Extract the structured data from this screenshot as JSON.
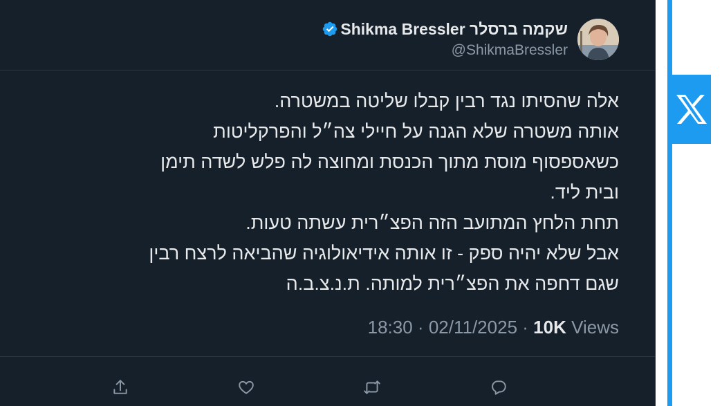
{
  "tweet": {
    "author": {
      "display_name": "Shikma Bressler שקמה ברסלר",
      "handle": "@ShikmaBressler",
      "verified": true
    },
    "text_lines": [
      "אלה שהסיתו נגד רבין קבלו שליטה במשטרה.",
      "אותה משטרה שלא הגנה על חיילי צה״ל והפרקליטות",
      "כשאספסוף מוסת מתוך הכנסת ומחוצה לה פלש לשדה תימן",
      "ובית ליד.",
      "תחת הלחץ המתועב הזה הפצ״רית עשתה טעות.",
      "אבל שלא יהיה ספק - זו אותה אידיאולוגיה שהביאה לרצח רבין",
      "שגם דחפה את הפצ״רית למותה. ת.נ.צ.ב.ה"
    ],
    "time": "18:30",
    "date": "02/11/2025",
    "separator": "·",
    "views_count": "10K",
    "views_label": "Views"
  },
  "colors": {
    "background": "#15202b",
    "text": "#e7e9ea",
    "secondary": "#8b98a5",
    "accent": "#1d9bf0",
    "divider": "#2f3336"
  },
  "icons": {
    "verified": "verified-badge-icon",
    "share": "share-icon",
    "like": "heart-icon",
    "retweet": "retweet-icon",
    "reply": "reply-icon",
    "brand": "x-logo-icon"
  }
}
